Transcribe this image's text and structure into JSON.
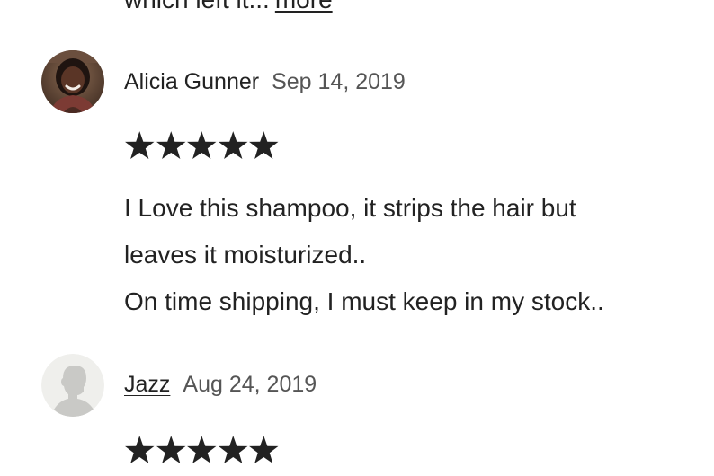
{
  "previous_review": {
    "snippet_text": "which left it...",
    "more_label": "more"
  },
  "reviews": [
    {
      "author": "Alicia Gunner",
      "date": "Sep 14, 2019",
      "rating": 5,
      "avatar": "photo-avatar",
      "body_lines": [
        "I Love this shampoo, it strips the hair but",
        "leaves it moisturized..",
        "On time shipping, I must keep in my stock.."
      ]
    },
    {
      "author": "Jazz",
      "date": "Aug 24, 2019",
      "rating": 5,
      "avatar": "default-silhouette-avatar"
    }
  ],
  "colors": {
    "text": "#222222",
    "date": "#555555",
    "star": "#222222",
    "placeholder_avatar_bg": "#efefec",
    "placeholder_avatar_fg": "#c9c9c6"
  },
  "icons": {
    "star": "star-icon",
    "avatar_placeholder": "person-silhouette-icon"
  }
}
